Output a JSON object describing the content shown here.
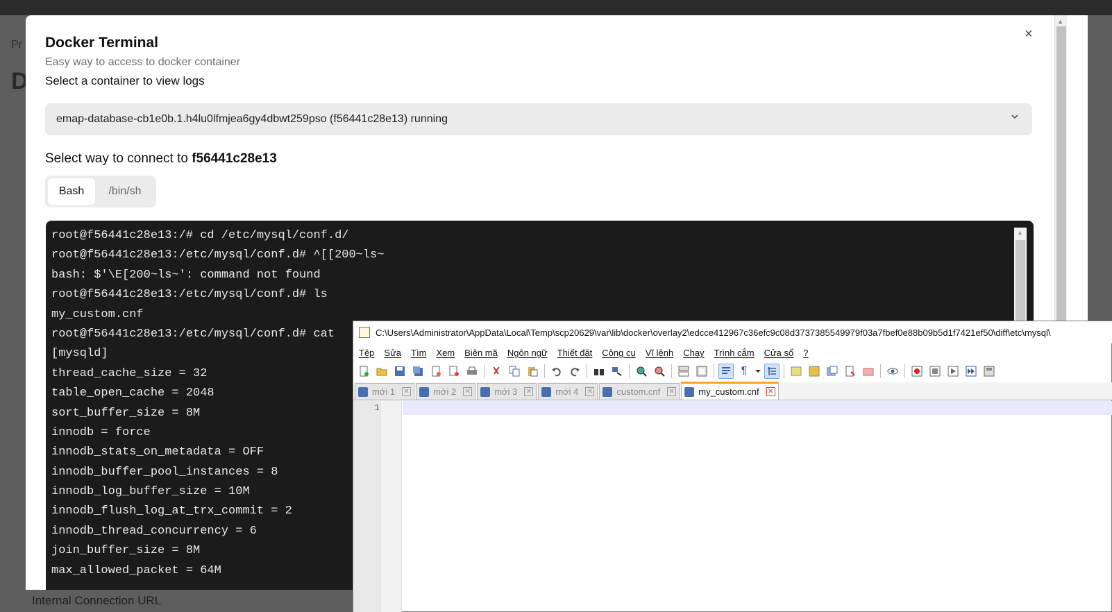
{
  "background": {
    "partial_left_text": "Pr",
    "partial_heading": "D",
    "bottom_label": "Internal Connection URL"
  },
  "modal": {
    "title": "Docker Terminal",
    "subtitle": "Easy way to access to docker container",
    "select_label": "Select a container to view logs",
    "close_symbol": "×",
    "container_select_value": "emap-database-cb1e0b.1.h4lu0lfmjea6gy4dbwt259pso (f56441c28e13) running",
    "connect_prefix": "Select way to connect to",
    "container_id": "f56441c28e13",
    "tabs": [
      {
        "label": "Bash",
        "active": true
      },
      {
        "label": "/bin/sh",
        "active": false
      }
    ]
  },
  "terminal": {
    "lines": [
      "root@f56441c28e13:/# cd /etc/mysql/conf.d/",
      "root@f56441c28e13:/etc/mysql/conf.d# ^[[200~ls~",
      "bash: $'\\E[200~ls~': command not found",
      "root@f56441c28e13:/etc/mysql/conf.d# ls",
      "my_custom.cnf",
      "root@f56441c28e13:/etc/mysql/conf.d# cat",
      "[mysqld]",
      "thread_cache_size = 32",
      "table_open_cache = 2048",
      "sort_buffer_size = 8M",
      "innodb = force",
      "innodb_stats_on_metadata = OFF",
      "innodb_buffer_pool_instances = 8",
      "innodb_log_buffer_size = 10M",
      "innodb_flush_log_at_trx_commit = 2",
      "innodb_thread_concurrency = 6",
      "join_buffer_size = 8M",
      "max_allowed_packet = 64M"
    ]
  },
  "notepad": {
    "title_path": "C:\\Users\\Administrator\\AppData\\Local\\Temp\\scp20629\\var\\lib\\docker\\overlay2\\edcce412967c36efc9c08d3737385549979f03a7fbef0e88b09b5d1f7421ef50\\diff\\etc\\mysql\\",
    "menu": [
      "Tệp",
      "Sửa",
      "Tìm",
      "Xem",
      "Biên mã",
      "Ngôn ngữ",
      "Thiết đặt",
      "Công cụ",
      "Vĩ lệnh",
      "Chạy",
      "Trình cắm",
      "Cửa sổ",
      "?"
    ],
    "tabs": [
      {
        "label": "mới 1",
        "active": false
      },
      {
        "label": "mới 2",
        "active": false
      },
      {
        "label": "mới 3",
        "active": false
      },
      {
        "label": "mới 4",
        "active": false
      },
      {
        "label": "custom.cnf",
        "active": false
      },
      {
        "label": "my_custom.cnf",
        "active": true
      }
    ],
    "line_number": "1",
    "toolbar_icons": [
      "new-file-icon",
      "open-file-icon",
      "save-icon",
      "save-all-icon",
      "close-icon",
      "close-all-icon",
      "print-icon",
      "cut-icon",
      "copy-icon",
      "paste-icon",
      "undo-icon",
      "redo-icon",
      "find-icon",
      "replace-icon",
      "zoom-in-icon",
      "zoom-out-icon",
      "sync-v-icon",
      "sync-h-icon",
      "word-wrap-icon",
      "show-all-chars-icon",
      "indent-guide-icon",
      "doc-map-icon",
      "function-list-icon",
      "folder-workspace-icon",
      "doc-list-icon",
      "monitor-icon",
      "record-macro-icon",
      "stop-macro-icon",
      "play-macro-icon",
      "run-macro-multiple-icon",
      "save-macro-icon"
    ]
  },
  "colors": {
    "terminal_bg": "#1b1b1b",
    "terminal_fg": "#e8e8e8",
    "active_tab_accent": "#f5a623"
  }
}
